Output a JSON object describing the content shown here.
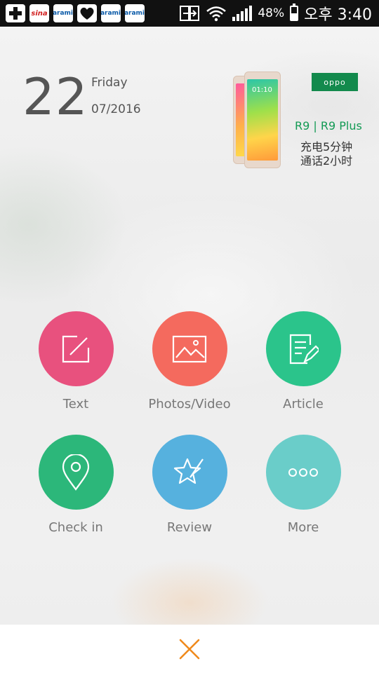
{
  "status_bar": {
    "icons": [
      "medical-cross-icon",
      "sina-icon",
      "saramin-icon",
      "heart-icon",
      "saramin-icon",
      "saramin-icon"
    ],
    "app_labels": [
      "sina",
      "saramin",
      "saramin",
      "saramin"
    ],
    "battery_percent": "48%",
    "battery_level": 0.48,
    "time": "오후 3:40"
  },
  "date": {
    "day": "22",
    "weekday": "Friday",
    "month_year": "07/2016"
  },
  "ad": {
    "brand": "oppo",
    "brand_color": "#138a4d",
    "phone_clock": "01:10",
    "model": "R9 | R9 Plus",
    "line1": "充电5分钟",
    "line2": "通话2小时"
  },
  "actions": [
    {
      "label": "Text",
      "icon": "edit-icon",
      "color": "#e8517e"
    },
    {
      "label": "Photos/Video",
      "icon": "image-icon",
      "color": "#f46a5e"
    },
    {
      "label": "Article",
      "icon": "document-edit-icon",
      "color": "#2bc48b"
    },
    {
      "label": "Check in",
      "icon": "location-pin-icon",
      "color": "#2cb77a"
    },
    {
      "label": "Review",
      "icon": "star-pen-icon",
      "color": "#56b1de"
    },
    {
      "label": "More",
      "icon": "more-dots-icon",
      "color": "#6acdc9"
    }
  ],
  "bottom_bar": {
    "close_icon": "close-icon",
    "close_color": "#f08a1c"
  }
}
